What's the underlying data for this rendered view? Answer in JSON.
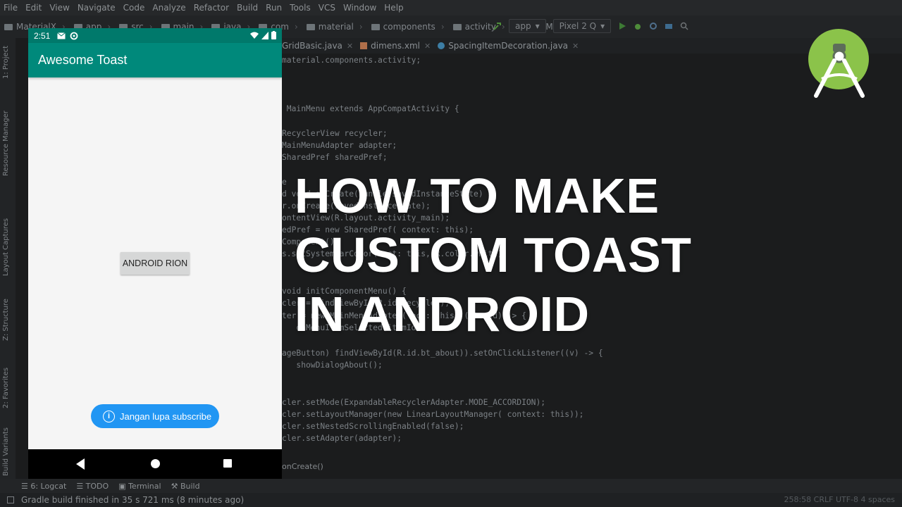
{
  "ide": {
    "menu": [
      "File",
      "Edit",
      "View",
      "Navigate",
      "Code",
      "Analyze",
      "Refactor",
      "Build",
      "Run",
      "Tools",
      "VCS",
      "Window",
      "Help"
    ],
    "breadcrumbs": [
      "MaterialX",
      "app",
      "src",
      "main",
      "java",
      "com",
      "material",
      "components",
      "activity"
    ],
    "breadcrumb_class": "MainMenu",
    "run_config": "app",
    "device": "Pixel 2 Q",
    "tabs": [
      {
        "label": "GridBasic.java",
        "type": "java"
      },
      {
        "label": "dimens.xml",
        "type": "xml"
      },
      {
        "label": "SpacingItemDecoration.java",
        "type": "java"
      }
    ],
    "left_panels": [
      "1: Project",
      "Resource Manager",
      "Layout Captures",
      "Z: Structure",
      "2: Favorites",
      "Build Variants"
    ],
    "code_lines": [
      "material.components.activity;",
      "",
      "",
      "",
      " MainMenu extends AppCompatActivity {",
      "",
      "RecyclerView recycler;",
      "MainMenuAdapter adapter;",
      "SharedPref sharedPref;",
      "",
      "e",
      "d void onCreate(Bundle savedInstanceState) {",
      "r.onCreate(savedInstanceState);",
      "ontentView(R.layout.activity_main);",
      "edPref = new SharedPref( context: this);",
      "Component();",
      "s.setSystemBarColor( act: this, R.color.white);",
      "",
      "void initComponentMenu() {",
      "cler = findViewById(R.id.recycler);",
      "ter = new MainMenuAdapter( act: this, (itemId) -> {",
      "   onMenuItemSelected(itemId);",
      "",
      "ageButton) findViewById(R.id.bt_about)).setOnClickListener((v) -> {",
      "   showDialogAbout();",
      "",
      "",
      "cler.setMode(ExpandableRecyclerAdapter.MODE_ACCORDION);",
      "cler.setLayoutManager(new LinearLayoutManager( context: this));",
      "cler.setNestedScrollingEnabled(false);",
      "cler.setAdapter(adapter);"
    ],
    "method_breadcrumb": "onCreate()",
    "bottom_tools": [
      "6: Logcat",
      "TODO",
      "Terminal",
      "Build"
    ],
    "status_message": "Gradle build finished in 35 s 721 ms (8 minutes ago)",
    "status_right": "258:58  CRLF  UTF-8  4 spaces"
  },
  "headline": [
    "HOW TO MAKE",
    "CUSTOM TOAST",
    "IN ANDROID"
  ],
  "phone": {
    "time": "2:51",
    "app_title": "Awesome Toast",
    "button_label": "ANDROID RION",
    "toast_text": "Jangan lupa subscribe",
    "colors": {
      "status": "#00796b",
      "appbar": "#00897b",
      "toast": "#2196f3"
    }
  },
  "logo": {
    "name": "android-studio-logo",
    "colors": {
      "circle": "#8bc34a",
      "body": "#ffffff"
    }
  }
}
